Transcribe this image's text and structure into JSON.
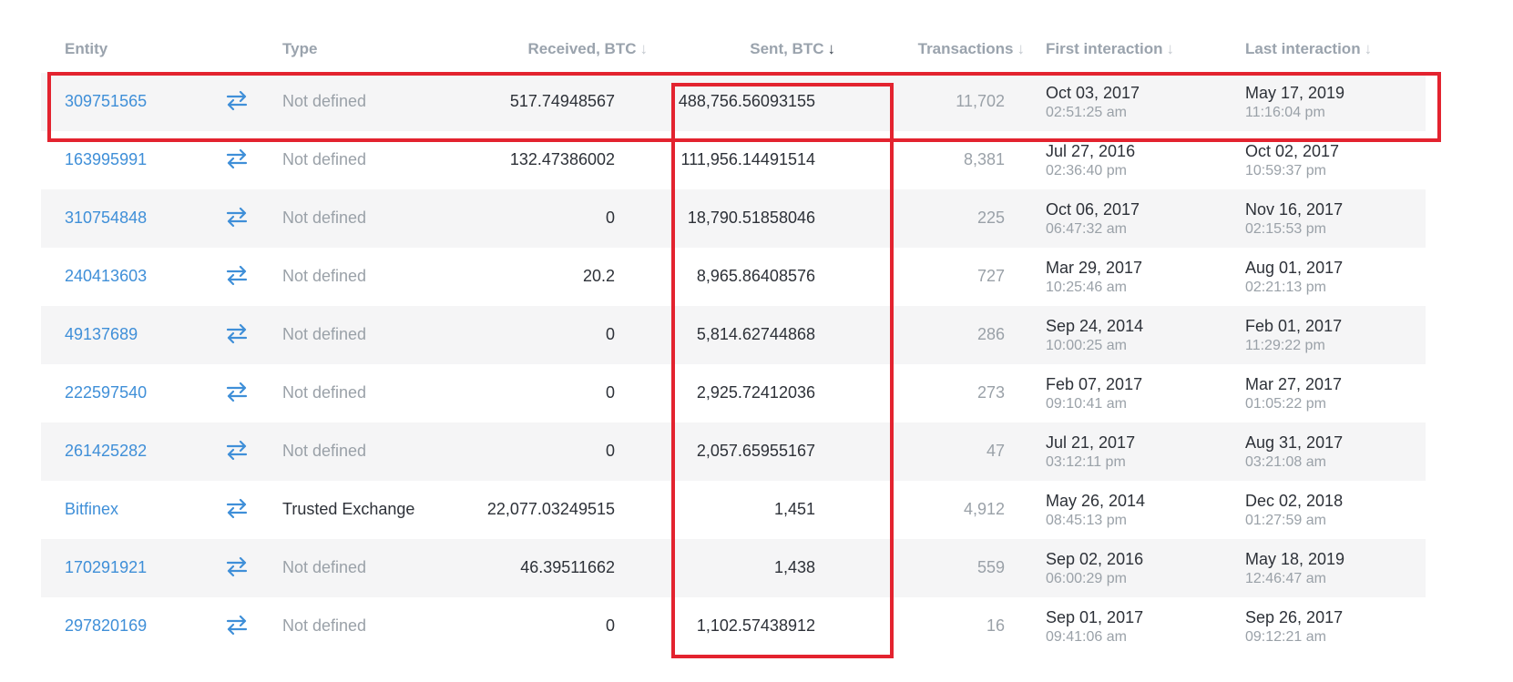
{
  "headers": {
    "entity": "Entity",
    "type": "Type",
    "received": "Received, BTC",
    "sent": "Sent, BTC",
    "transactions": "Transactions",
    "first_interaction": "First interaction",
    "last_interaction": "Last interaction",
    "sort_arrow": "↓"
  },
  "sort": {
    "active_column": "sent",
    "direction": "desc"
  },
  "icons": {
    "row_action": "swap-arrows-icon"
  },
  "colors": {
    "link": "#3f8fd8",
    "highlight": "#e3232f"
  },
  "rows": [
    {
      "entity": "309751565",
      "type": "Not defined",
      "received": "517.74948567",
      "sent": "488,756.56093155",
      "transactions": "11,702",
      "first_date": "Oct 03, 2017",
      "first_time": "02:51:25 am",
      "last_date": "May 17, 2019",
      "last_time": "11:16:04 pm"
    },
    {
      "entity": "163995991",
      "type": "Not defined",
      "received": "132.47386002",
      "sent": "111,956.14491514",
      "transactions": "8,381",
      "first_date": "Jul 27, 2016",
      "first_time": "02:36:40 pm",
      "last_date": "Oct 02, 2017",
      "last_time": "10:59:37 pm"
    },
    {
      "entity": "310754848",
      "type": "Not defined",
      "received": "0",
      "sent": "18,790.51858046",
      "transactions": "225",
      "first_date": "Oct 06, 2017",
      "first_time": "06:47:32 am",
      "last_date": "Nov 16, 2017",
      "last_time": "02:15:53 pm"
    },
    {
      "entity": "240413603",
      "type": "Not defined",
      "received": "20.2",
      "sent": "8,965.86408576",
      "transactions": "727",
      "first_date": "Mar 29, 2017",
      "first_time": "10:25:46 am",
      "last_date": "Aug 01, 2017",
      "last_time": "02:21:13 pm"
    },
    {
      "entity": "49137689",
      "type": "Not defined",
      "received": "0",
      "sent": "5,814.62744868",
      "transactions": "286",
      "first_date": "Sep 24, 2014",
      "first_time": "10:00:25 am",
      "last_date": "Feb 01, 2017",
      "last_time": "11:29:22 pm"
    },
    {
      "entity": "222597540",
      "type": "Not defined",
      "received": "0",
      "sent": "2,925.72412036",
      "transactions": "273",
      "first_date": "Feb 07, 2017",
      "first_time": "09:10:41 am",
      "last_date": "Mar 27, 2017",
      "last_time": "01:05:22 pm"
    },
    {
      "entity": "261425282",
      "type": "Not defined",
      "received": "0",
      "sent": "2,057.65955167",
      "transactions": "47",
      "first_date": "Jul 21, 2017",
      "first_time": "03:12:11 pm",
      "last_date": "Aug 31, 2017",
      "last_time": "03:21:08 am"
    },
    {
      "entity": "Bitfinex",
      "type": "Trusted Exchange",
      "received": "22,077.03249515",
      "sent": "1,451",
      "transactions": "4,912",
      "first_date": "May 26, 2014",
      "first_time": "08:45:13 pm",
      "last_date": "Dec 02, 2018",
      "last_time": "01:27:59 am"
    },
    {
      "entity": "170291921",
      "type": "Not defined",
      "received": "46.39511662",
      "sent": "1,438",
      "transactions": "559",
      "first_date": "Sep 02, 2016",
      "first_time": "06:00:29 pm",
      "last_date": "May 18, 2019",
      "last_time": "12:46:47 am"
    },
    {
      "entity": "297820169",
      "type": "Not defined",
      "received": "0",
      "sent": "1,102.57438912",
      "transactions": "16",
      "first_date": "Sep 01, 2017",
      "first_time": "09:41:06 am",
      "last_date": "Sep 26, 2017",
      "last_time": "09:12:21 am"
    }
  ]
}
